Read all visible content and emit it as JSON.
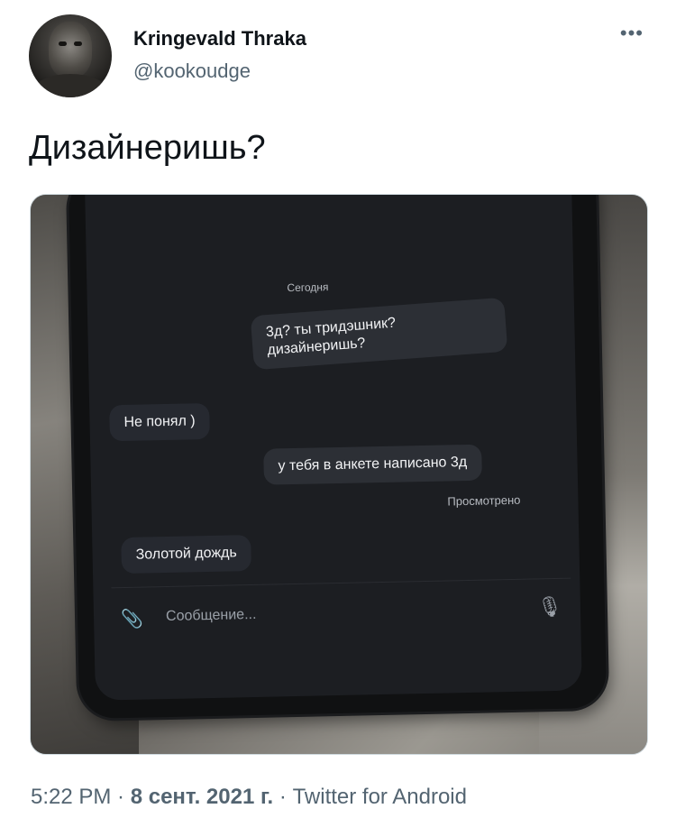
{
  "tweet": {
    "author_name": "Kringevald Thraka",
    "author_handle": "@kookoudge",
    "more_icon": "•••",
    "text": "Дизайнеришь?"
  },
  "screenshot": {
    "today_label": "Сегодня",
    "messages": [
      {
        "side": "out",
        "text": "3д? ты тридэшник? дизайнеришь?"
      },
      {
        "side": "in",
        "text": "Не понял )"
      },
      {
        "side": "out",
        "text": "у тебя в анкете написано 3д"
      },
      {
        "side": "in",
        "text": "Золотой дождь"
      }
    ],
    "seen_label": "Просмотрено",
    "composer_placeholder": "Сообщение..."
  },
  "footer": {
    "time": "5:22 PM",
    "separator": " · ",
    "date": "8 сент. 2021 г.",
    "source": "Twitter for Android"
  }
}
